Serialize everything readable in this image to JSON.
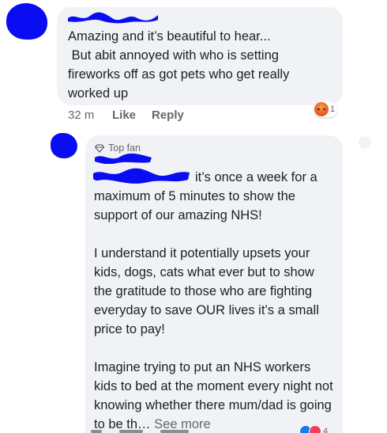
{
  "comment_1": {
    "text": "Amazing and it’s beautiful to hear...\n But abit annoyed with who is setting fireworks off as got pets who get really worked up",
    "time": "32 m",
    "like_label": "Like",
    "reply_label": "Reply",
    "reaction_icon": "angry-reaction-icon",
    "reaction_count": "1"
  },
  "comment_2": {
    "badge": "Top fan",
    "badge_icon": "diamond-icon",
    "text_line1": "it’s once a week for a",
    "text_rest": "maximum of 5 minutes to show the support of our amazing NHS!\n\nI understand it potentially upsets your kids, dogs, cats what ever but to show the gratitude to those who are fighting everyday to save OUR lives it’s a small price to pay!\n\nImagine trying to put an NHS workers kids to bed at the moment every night not knowing whether there mum/dad is going to be th… ",
    "see_more": "See more",
    "reaction_count": "4"
  },
  "colors": {
    "redaction": "#0a0cf2",
    "bubble": "#f0f2f5",
    "meta": "#65676b"
  }
}
